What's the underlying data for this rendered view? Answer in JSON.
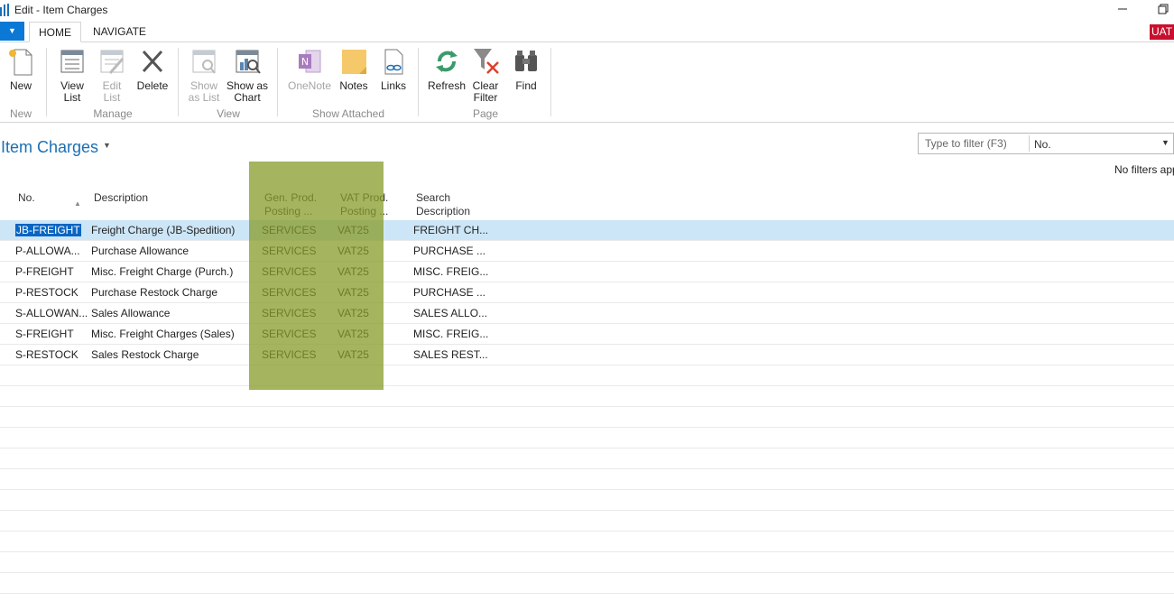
{
  "window": {
    "title": "Edit - Item Charges"
  },
  "ribbon": {
    "tabs": [
      {
        "label": "HOME"
      },
      {
        "label": "NAVIGATE"
      }
    ],
    "environment_badge": "UAT",
    "buttons": {
      "new": "New",
      "view_list": [
        "View",
        "List"
      ],
      "edit_list": [
        "Edit",
        "List"
      ],
      "delete": "Delete",
      "show_as_list": [
        "Show",
        "as List"
      ],
      "show_as_chart": [
        "Show as",
        "Chart"
      ],
      "onenote": "OneNote",
      "notes": "Notes",
      "links": "Links",
      "refresh": "Refresh",
      "clear_filter": [
        "Clear",
        "Filter"
      ],
      "find": "Find"
    },
    "groups": {
      "new": "New",
      "manage": "Manage",
      "view": "View",
      "show_attached": "Show Attached",
      "page": "Page"
    }
  },
  "page": {
    "title": "Item Charges",
    "filter": {
      "placeholder": "Type to filter (F3)",
      "field": "No."
    },
    "no_filters": "No filters applied"
  },
  "table": {
    "headers": {
      "no": "No.",
      "description": "Description",
      "gen_prod": [
        "Gen. Prod.",
        "Posting ..."
      ],
      "vat_prod": [
        "VAT Prod.",
        "Posting ..."
      ],
      "search": [
        "Search",
        "Description"
      ]
    },
    "rows": [
      {
        "no": "JB-FREIGHT",
        "description": "Freight Charge (JB-Spedition)",
        "gen": "SERVICES",
        "vat": "VAT25",
        "search": "FREIGHT CH..."
      },
      {
        "no": "P-ALLOWA...",
        "description": "Purchase Allowance",
        "gen": "SERVICES",
        "vat": "VAT25",
        "search": "PURCHASE ..."
      },
      {
        "no": "P-FREIGHT",
        "description": "Misc. Freight Charge (Purch.)",
        "gen": "SERVICES",
        "vat": "VAT25",
        "search": "MISC. FREIG..."
      },
      {
        "no": "P-RESTOCK",
        "description": "Purchase Restock Charge",
        "gen": "SERVICES",
        "vat": "VAT25",
        "search": "PURCHASE ..."
      },
      {
        "no": "S-ALLOWAN...",
        "description": "Sales Allowance",
        "gen": "SERVICES",
        "vat": "VAT25",
        "search": "SALES ALLO..."
      },
      {
        "no": "S-FREIGHT",
        "description": "Misc. Freight Charges (Sales)",
        "gen": "SERVICES",
        "vat": "VAT25",
        "search": "MISC. FREIG..."
      },
      {
        "no": "S-RESTOCK",
        "description": "Sales Restock Charge",
        "gen": "SERVICES",
        "vat": "VAT25",
        "search": "SALES REST..."
      }
    ]
  },
  "colors": {
    "accent": "#1b6fb5",
    "selected_row": "#cde6f7",
    "highlight": "#879b28",
    "badge": "#c8102e"
  }
}
